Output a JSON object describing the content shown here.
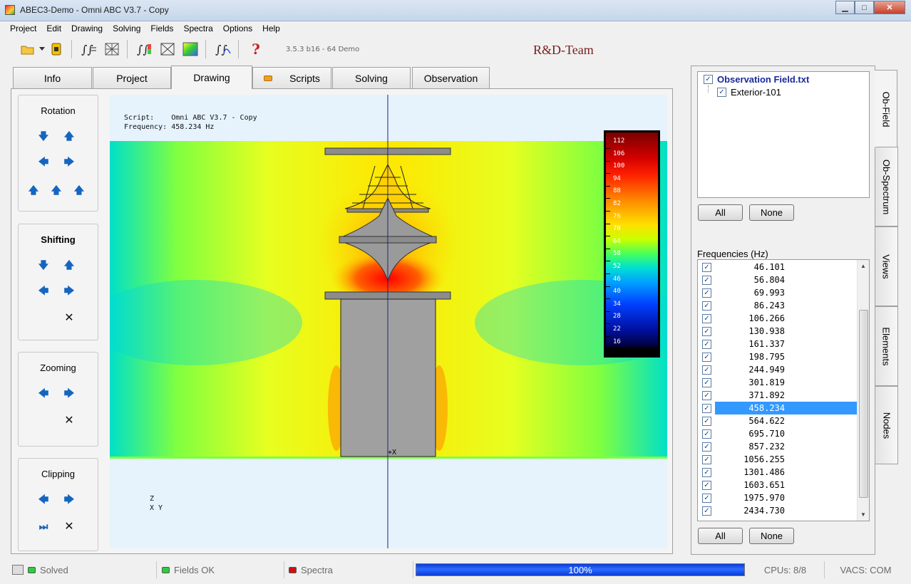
{
  "window": {
    "title": "ABEC3-Demo - Omni ABC V3.7 - Copy",
    "min_label": "▁",
    "max_label": "□",
    "close_label": "✕"
  },
  "menu": [
    "Project",
    "Edit",
    "Drawing",
    "Solving",
    "Fields",
    "Spectra",
    "Options",
    "Help"
  ],
  "toolbar": {
    "version": "3.5.3 b16 - 64 Demo",
    "brand": "R&D-Team",
    "help_glyph": "?"
  },
  "tabs": [
    "Info",
    "Project",
    "Drawing",
    "Scripts",
    "Solving",
    "Observation"
  ],
  "active_tab": "Drawing",
  "left_controls": {
    "rotation_title": "Rotation",
    "shifting_title": "Shifting",
    "zooming_title": "Zooming",
    "clipping_title": "Clipping"
  },
  "viewport": {
    "script_line": "Script:    Omni ABC V3.7 - Copy",
    "frequency_line": "Frequency: 458.234 Hz",
    "origin_marker": "+X",
    "axis_z": "Z",
    "axis_xy": "X  Y",
    "colorbar_labels": [
      "112",
      "106",
      "100",
      "94",
      "88",
      "82",
      "76",
      "70",
      "64",
      "58",
      "52",
      "46",
      "40",
      "34",
      "28",
      "22",
      "16"
    ]
  },
  "observation": {
    "file": "Observation Field.txt",
    "child": "Exterior-101",
    "all_label": "All",
    "none_label": "None"
  },
  "frequencies": {
    "label": "Frequencies  (Hz)",
    "values": [
      "46.101",
      "56.804",
      "69.993",
      "86.243",
      "106.266",
      "130.938",
      "161.337",
      "198.795",
      "244.949",
      "301.819",
      "371.892",
      "458.234",
      "564.622",
      "695.710",
      "857.232",
      "1056.255",
      "1301.486",
      "1603.651",
      "1975.970",
      "2434.730"
    ],
    "selected": "458.234",
    "all_label": "All",
    "none_label": "None"
  },
  "side_tabs": [
    "Ob-Field",
    "Ob-Spectrum",
    "Views",
    "Elements",
    "Nodes"
  ],
  "status": {
    "solved": "Solved",
    "fields": "Fields OK",
    "spectra": "Spectra",
    "progress_label": "100%",
    "progress_value": 1.0,
    "cpus": "CPUs: 8/8",
    "vacs": "VACS: COM"
  },
  "colors": {
    "solved_led": "#2ecc40",
    "fields_led": "#2ecc40",
    "spectra_led": "#d01010",
    "progress": "#1f5cff"
  }
}
